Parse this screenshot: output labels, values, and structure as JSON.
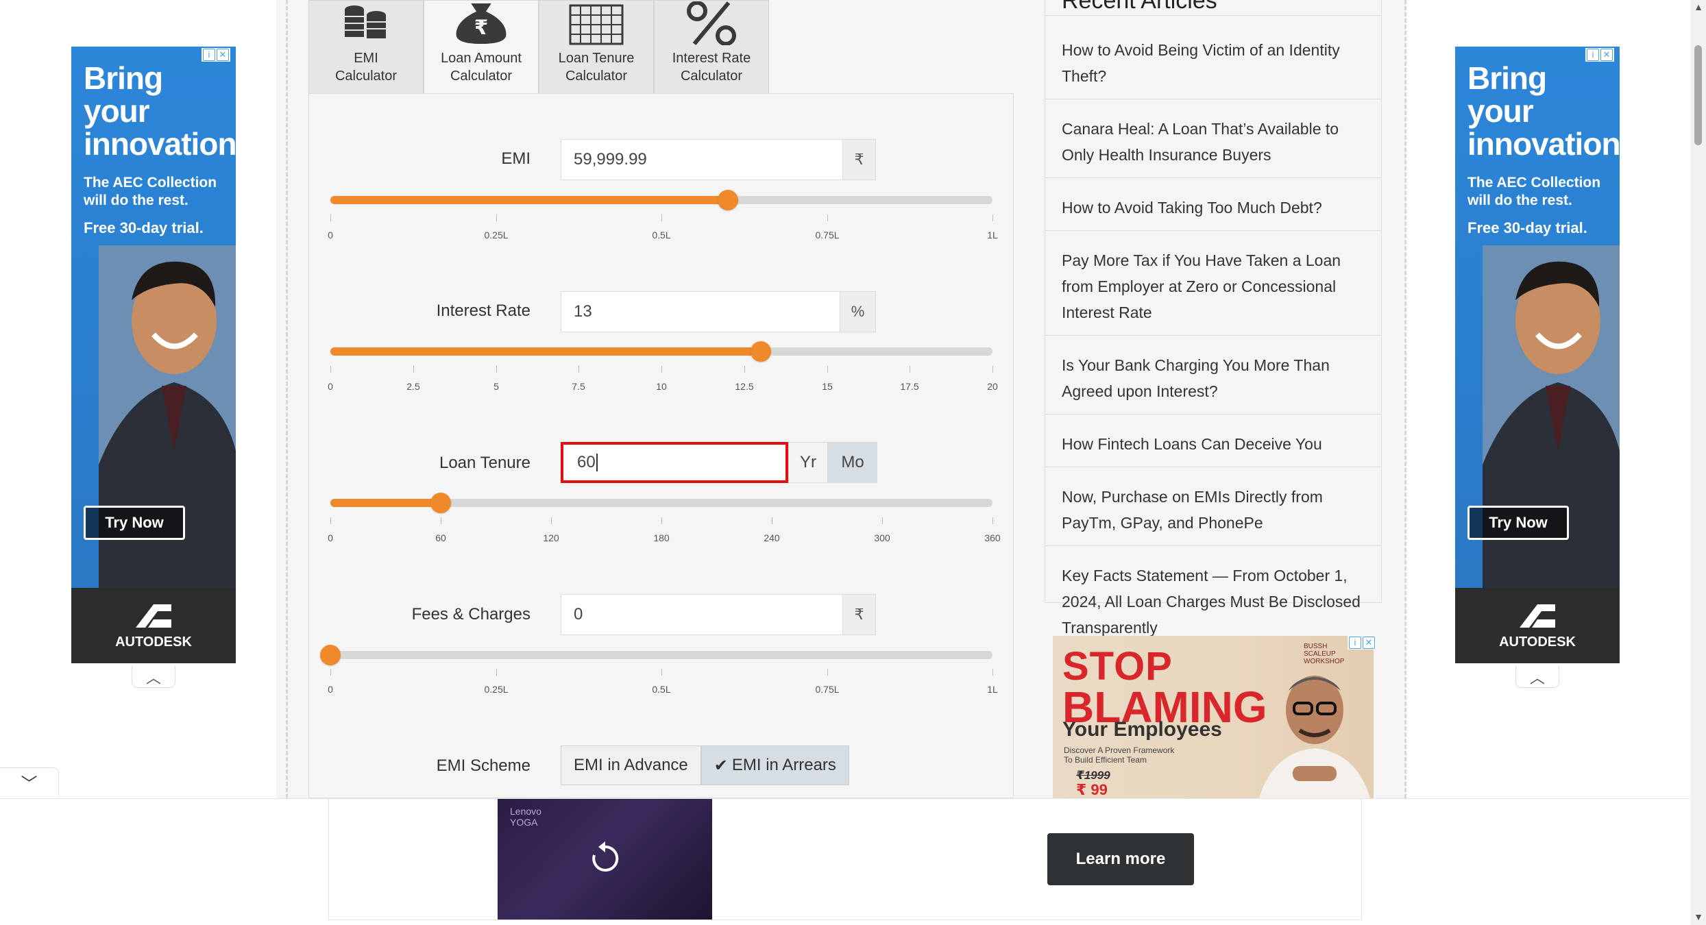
{
  "tabs": [
    {
      "label": "EMI\nCalculator",
      "icon": "coins-icon"
    },
    {
      "label": "Loan Amount\nCalculator",
      "icon": "rupee-bag-icon"
    },
    {
      "label": "Loan Tenure\nCalculator",
      "icon": "calendar-grid-icon"
    },
    {
      "label": "Interest Rate\nCalculator",
      "icon": "percent-icon"
    }
  ],
  "active_tab": "Loan Amount\nCalculator",
  "emi": {
    "label": "EMI",
    "value": "59,999.99",
    "unit": "₹",
    "slider_fraction": 0.6,
    "ticks": [
      "0",
      "0.25L",
      "0.5L",
      "0.75L",
      "1L"
    ]
  },
  "interest": {
    "label": "Interest Rate",
    "value": "13",
    "unit": "%",
    "slider_value": 13,
    "slider_max": 20,
    "ticks": [
      "0",
      "2.5",
      "5",
      "7.5",
      "10",
      "12.5",
      "15",
      "17.5",
      "20"
    ]
  },
  "tenure": {
    "label": "Loan Tenure",
    "value": "60",
    "yr_label": "Yr",
    "mo_label": "Mo",
    "selected_unit": "Mo",
    "slider_value": 60,
    "slider_max": 360,
    "ticks": [
      "0",
      "60",
      "120",
      "180",
      "240",
      "300",
      "360"
    ]
  },
  "fees": {
    "label": "Fees & Charges",
    "value": "0",
    "unit": "₹",
    "slider_fraction": 0,
    "ticks": [
      "0",
      "0.25L",
      "0.5L",
      "0.75L",
      "1L"
    ]
  },
  "scheme": {
    "label": "EMI Scheme",
    "options": [
      "EMI in Advance",
      "EMI in Arrears"
    ],
    "selected": "EMI in Arrears"
  },
  "recent_articles": {
    "title": "Recent Articles",
    "items": [
      "How to Avoid Being Victim of an Identity Theft?",
      "Canara Heal: A Loan That’s Available to Only Health Insurance Buyers",
      "How to Avoid Taking Too Much Debt?",
      "Pay More Tax if You Have Taken a Loan from Employer at Zero or Concessional Interest Rate",
      "Is Your Bank Charging You More Than Agreed upon Interest?",
      "How Fintech Loans Can Deceive You",
      "Now, Purchase on EMIs Directly from PayTm, GPay, and PhonePe",
      "Key Facts Statement — From October 1, 2024, All Loan Charges Must Be Disclosed Transparently"
    ]
  },
  "side_ad": {
    "headline": "Bring your innovation",
    "sub": "The AEC Collection will do the rest.",
    "trial": "Free 30-day trial.",
    "button": "Try Now",
    "brand": "AUTODESK"
  },
  "blame_ad": {
    "line1": "STOP",
    "line2": "BLAMING",
    "line3": "Your Employees",
    "desc": "Discover A Proven Framework To Build Efficient Team",
    "old_price": "₹1999",
    "price": "₹ 99",
    "badge": "BUSSH SCALEUP WORKSHOP"
  },
  "bottom_ad": {
    "brand": "Lenovo YOGA",
    "button": "Learn more"
  },
  "colors": {
    "accent": "#f0892a",
    "focus_border": "#e01010",
    "ad_blue": "#2d87d8",
    "ad_red": "#d8262a"
  }
}
